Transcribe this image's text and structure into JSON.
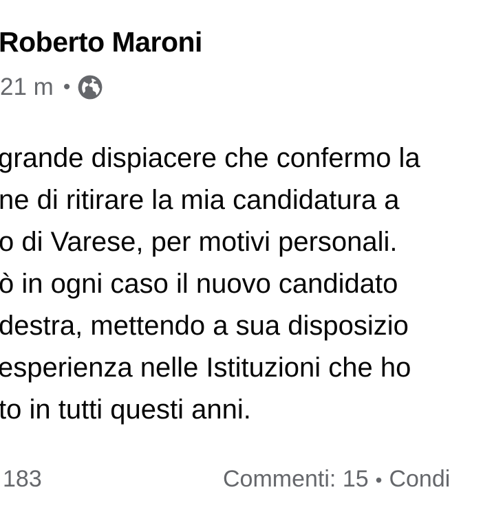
{
  "post": {
    "author": "Roberto Maroni",
    "time": "21 m",
    "separator": "•",
    "privacy_icon": "globe-icon",
    "lines": [
      "grande dispiacere che confermo la",
      "ne di ritirare la mia candidatura a",
      "o di Varese, per motivi personali.",
      "ò in ogni caso il nuovo candidato",
      "destra, mettendo a sua disposizio",
      "esperienza nelle Istituzioni che ho",
      "to in tutti questi anni."
    ],
    "reactions_count": "183",
    "comments_label": "Commenti: 15",
    "footer_separator": "•",
    "shares_label": "Condi"
  },
  "colors": {
    "text_primary": "#050505",
    "text_secondary": "#65676b",
    "background": "#ffffff"
  }
}
